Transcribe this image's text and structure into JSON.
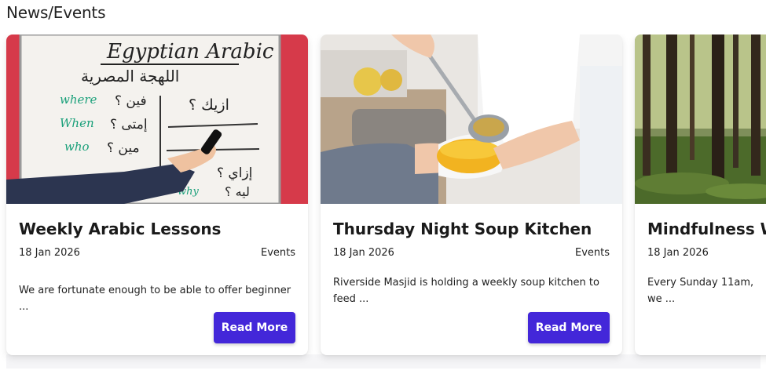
{
  "section": {
    "title": "News/Events"
  },
  "cards": [
    {
      "image": "whiteboard-arabic-lesson-image",
      "title": "Weekly Arabic Lessons",
      "date": "18 Jan 2026",
      "category": "Events",
      "description": "We are fortunate enough to be able to offer beginner ...",
      "button": "Read More"
    },
    {
      "image": "soup-kitchen-serving-image",
      "title": "Thursday Night Soup Kitchen",
      "date": "18 Jan 2026",
      "category": "Events",
      "description": "Riverside Masjid is holding a weekly soup kitchen to feed ...",
      "button": "Read More"
    },
    {
      "image": "forest-trees-image",
      "title": "Mindfulness Wa",
      "date": "18 Jan 2026",
      "category": "",
      "description": "Every Sunday 11am, we ...",
      "button": ""
    }
  ],
  "board_text": {
    "heading": "Egyptian Arabic",
    "subheading": "اللهجة المصرية",
    "words": [
      "where",
      "When",
      "who",
      "why"
    ],
    "arabic": [
      "فين ؟",
      "إمتى ؟",
      "مين ؟",
      "ازيك ؟",
      "إزاي ؟",
      "ليه ؟"
    ]
  },
  "colors": {
    "accent": "#4327d9"
  }
}
